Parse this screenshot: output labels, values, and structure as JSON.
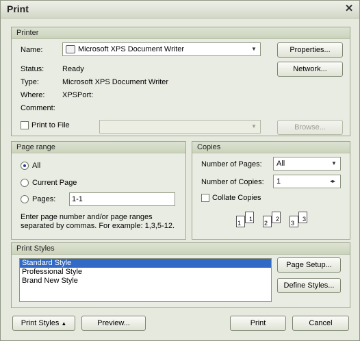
{
  "window": {
    "title": "Print"
  },
  "printer": {
    "group_label": "Printer",
    "name_label": "Name:",
    "name_value": "Microsoft XPS Document Writer",
    "status_label": "Status:",
    "status_value": "Ready",
    "type_label": "Type:",
    "type_value": "Microsoft XPS Document Writer",
    "where_label": "Where:",
    "where_value": "XPSPort:",
    "comment_label": "Comment:",
    "comment_value": "",
    "print_to_file_label": "Print to File",
    "print_to_file_checked": false,
    "file_path_value": "",
    "properties_button": "Properties...",
    "network_button": "Network...",
    "browse_button": "Browse..."
  },
  "page_range": {
    "group_label": "Page range",
    "all_label": "All",
    "current_page_label": "Current Page",
    "pages_label": "Pages:",
    "pages_value": "1-1",
    "selected": "All",
    "hint": "Enter page number and/or page ranges separated by commas. For example: 1,3,5-12."
  },
  "copies": {
    "group_label": "Copies",
    "number_of_pages_label": "Number of Pages:",
    "number_of_pages_value": "All",
    "number_of_copies_label": "Number of Copies:",
    "number_of_copies_value": "1",
    "collate_label": "Collate Copies",
    "collate_checked": false,
    "collate_pages": [
      "1",
      "1",
      "2",
      "2",
      "3",
      "3"
    ]
  },
  "print_styles": {
    "group_label": "Print Styles",
    "items": [
      "Standard Style",
      "Professional Style",
      "Brand New Style"
    ],
    "selected_index": 0,
    "page_setup_button": "Page Setup...",
    "define_styles_button": "Define Styles..."
  },
  "footer": {
    "print_styles_button": "Print Styles",
    "preview_button": "Preview...",
    "print_button": "Print",
    "cancel_button": "Cancel"
  },
  "colors": {
    "selection": "#3169c6",
    "window_bg": "#e6e9de",
    "group_border": "#9ca58f"
  }
}
